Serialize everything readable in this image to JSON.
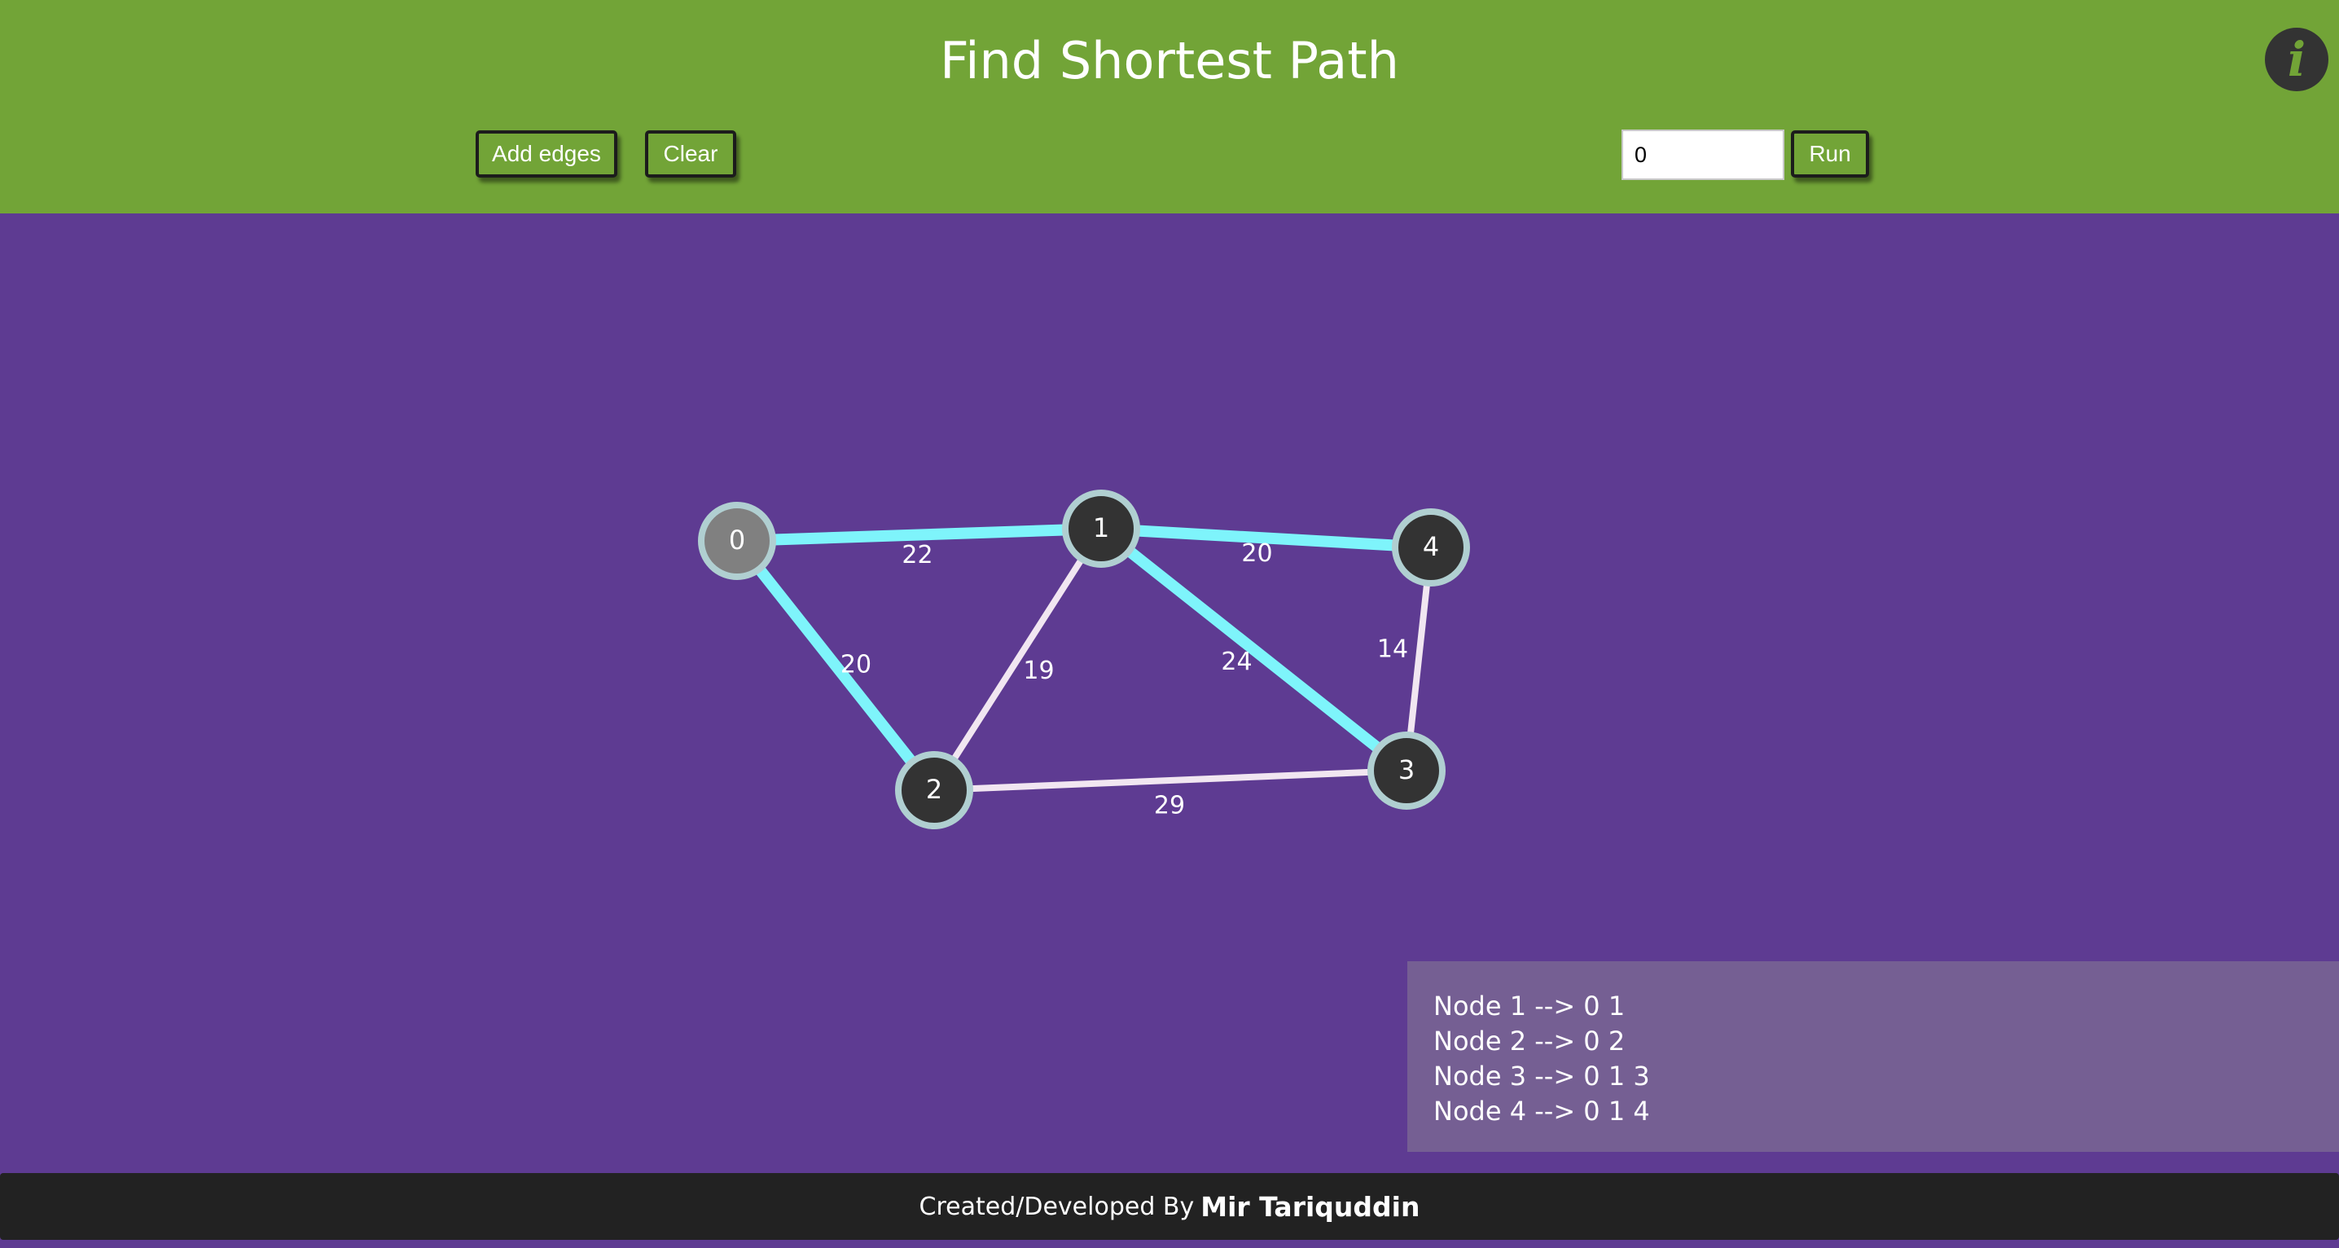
{
  "header": {
    "title": "Find Shortest Path",
    "add_edges_label": "Add edges",
    "clear_label": "Clear",
    "source_value": "0",
    "run_label": "Run",
    "info_icon": "info-icon",
    "info_glyph": "i"
  },
  "colors": {
    "header_bg": "#72a437",
    "canvas_bg": "#5e3b92",
    "path_edge": "#7ef4fb",
    "normal_edge": "#f1e6f1",
    "node_fill": "#333333",
    "source_node_fill": "#808080",
    "node_border": "#b0cfd1"
  },
  "graph": {
    "nodes": [
      {
        "id": "0",
        "source": true
      },
      {
        "id": "1"
      },
      {
        "id": "2"
      },
      {
        "id": "3"
      },
      {
        "id": "4"
      }
    ],
    "edges": [
      {
        "from": "0",
        "to": "1",
        "weight": "22",
        "in_path": true
      },
      {
        "from": "0",
        "to": "2",
        "weight": "20",
        "in_path": true
      },
      {
        "from": "1",
        "to": "2",
        "weight": "19",
        "in_path": false
      },
      {
        "from": "1",
        "to": "4",
        "weight": "20",
        "in_path": true
      },
      {
        "from": "1",
        "to": "3",
        "weight": "24",
        "in_path": true
      },
      {
        "from": "4",
        "to": "3",
        "weight": "14",
        "in_path": false
      },
      {
        "from": "2",
        "to": "3",
        "weight": "29",
        "in_path": false
      }
    ]
  },
  "results": [
    "Node 1 --> 0 1",
    "Node 2 --> 0 2",
    "Node 3 --> 0 1 3",
    "Node 4 --> 0 1 4"
  ],
  "footer": {
    "prefix": "Created/Developed By",
    "author": "Mir Tariquddin"
  }
}
